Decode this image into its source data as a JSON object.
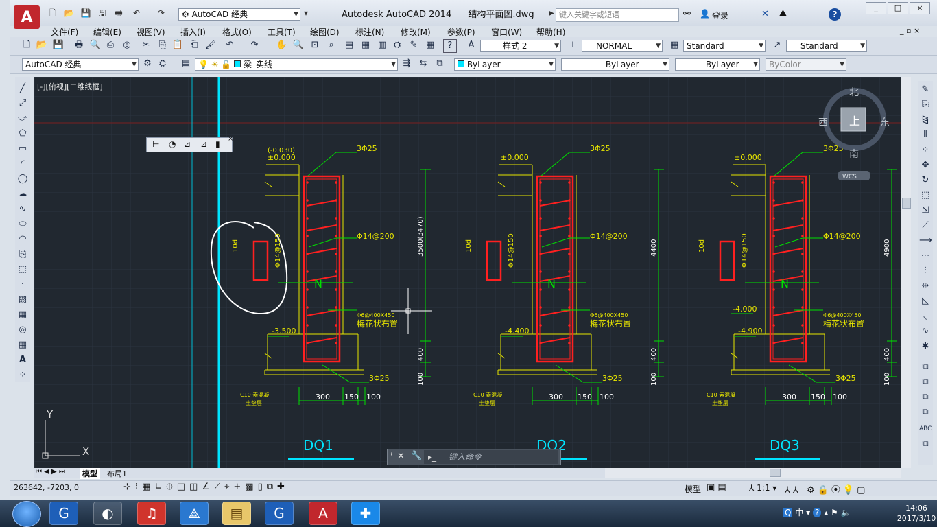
{
  "window": {
    "title": "Autodesk AutoCAD 2014",
    "filename": "结构平面图.dwg",
    "search_placeholder": "键入关键字或短语",
    "login": "登录",
    "controls": [
      "_",
      "□",
      "×"
    ]
  },
  "quick_access": {
    "workspace": "AutoCAD 经典"
  },
  "menu": [
    "文件(F)",
    "编辑(E)",
    "视图(V)",
    "插入(I)",
    "格式(O)",
    "工具(T)",
    "绘图(D)",
    "标注(N)",
    "修改(M)",
    "参数(P)",
    "窗口(W)",
    "帮助(H)"
  ],
  "toolbar_styles": {
    "text_style": "样式 2",
    "dim_style": "NORMAL",
    "table_style": "Standard",
    "multileader_style": "Standard"
  },
  "toolbar_layers": {
    "workspace": "AutoCAD 经典",
    "layer": "梁_实线",
    "color": "ByLayer",
    "linetype": "ByLayer",
    "lineweight": "ByLayer",
    "plotstyle": "ByColor"
  },
  "viewport_label": "[-][俯视][二维线框]",
  "viewcube": {
    "north": "北",
    "south": "南",
    "east": "东",
    "west": "西",
    "top": "上",
    "wcs": "WCS"
  },
  "ucs": {
    "x": "X",
    "y": "Y"
  },
  "drawing": {
    "sections": [
      {
        "name": "DQ1",
        "level_top": "±0.000",
        "level_top_alt": "(-0.030)",
        "level_bottom": "-3.500",
        "height_dim": "3500(3470)",
        "bottom_dim": "400",
        "base_dim": "100",
        "top_rebar": "3Φ25",
        "bottom_rebar": "3Φ25",
        "side_rebar": "Φ14@200",
        "stirrup": "Φ14@150",
        "tie": "Φ6@400X450",
        "tie_note": "梅花状布置",
        "pad": "C10 素混凝土垫层",
        "dims": [
          "300",
          "150",
          "100"
        ],
        "lap": "10d"
      },
      {
        "name": "DQ2",
        "level_top": "±0.000",
        "level_bottom": "-4.400",
        "height_dim": "4400",
        "bottom_dim": "400",
        "base_dim": "100",
        "top_rebar": "3Φ25",
        "bottom_rebar": "3Φ25",
        "side_rebar": "Φ14@200",
        "stirrup": "Φ14@150",
        "tie": "Φ6@400X450",
        "tie_note": "梅花状布置",
        "pad": "C10 素混凝土垫层",
        "dims": [
          "300",
          "150",
          "100"
        ],
        "lap": "10d"
      },
      {
        "name": "DQ3",
        "level_top": "±0.000",
        "level_mid": "-4.000",
        "level_bottom": "-4.900",
        "height_dim": "4900",
        "bottom_dim": "400",
        "base_dim": "100",
        "top_rebar": "3Φ25",
        "bottom_rebar": "3Φ25",
        "side_rebar": "Φ14@200",
        "stirrup": "Φ14@150",
        "tie": "Φ6@400X450",
        "tie_note": "梅花状布置",
        "pad": "C10 素混凝土垫层",
        "dims": [
          "300",
          "150",
          "100"
        ],
        "lap": "10d"
      }
    ]
  },
  "command": {
    "placeholder": "键入命令"
  },
  "tabs": [
    "模型",
    "布局1"
  ],
  "status": {
    "coords": "263642, -7203, 0",
    "model_label": "模型",
    "scale": "1:1"
  },
  "taskbar": {
    "time": "14:06",
    "date": "2017/3/10",
    "ime": "中"
  },
  "colors": {
    "canvas": "#212830",
    "yellow": "#e8e600",
    "green": "#00e000",
    "red": "#ff2020",
    "cyan": "#00e5ff",
    "white": "#ffffff"
  }
}
